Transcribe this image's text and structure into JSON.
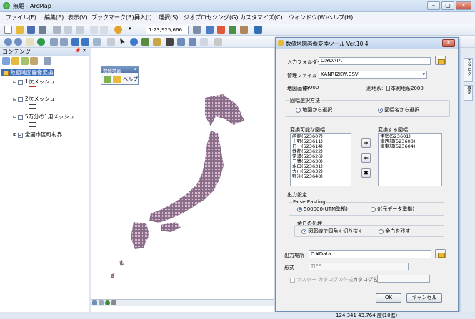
{
  "window": {
    "title": "無題 - ArcMap",
    "min": "–",
    "max": "▢",
    "close": "✕"
  },
  "menu": [
    "ファイル(F)",
    "編集(E)",
    "表示(V)",
    "ブックマーク(B)",
    "挿入(I)",
    "選択(S)",
    "ジオプロセシング(G)",
    "カスタマイズ(C)",
    "ウィンドウ(W)",
    "ヘルプ(H)"
  ],
  "toolbar": {
    "scale": "1:23,925,666"
  },
  "toc": {
    "title": "コンテンツ",
    "layer_group": "数値地図画像変換",
    "layers": [
      "1次メッシュ",
      "2次メッシュ",
      "5万分の1用メッシュ",
      "全国市区町村界"
    ]
  },
  "mini_toolbar": {
    "title": "数値地図",
    "help": "ヘルプ"
  },
  "dialog": {
    "title": "数値地図画像変換ツール Ver.10.4",
    "input_folder_label": "入力フォルダー",
    "input_folder_value": "C:¥DATA",
    "mgmt_file_label": "管理ファイル",
    "mgmt_file_value": "KANRI2KW.CSV",
    "map_image_label": "地図画像:",
    "map_image_value": "25000",
    "geodetic_label": "測地系:",
    "geodetic_value": "日本測地系2000",
    "selection_group": "図幅選択方法",
    "select_from_map": "地図から選択",
    "select_from_name": "図幅名から選択",
    "convertible_label": "変換可能な図幅",
    "convert_label": "変換する図幅",
    "convertible_list": [
      "函館(523607)",
      "上野(523611)",
      "日十(523614)",
      "鉄都(523622)",
      "常濃(523626)",
      "三豊(523630)",
      "水口(523631)",
      "大山(523632)",
      "野洲(523640)"
    ],
    "convert_list": [
      "伊勢(523601)",
      "津西部(523603)",
      "津東部(523604)"
    ],
    "output_group": "出力設定",
    "false_easting_label": "False Easting",
    "fe_opt1": "500000(UTM準拠)",
    "fe_opt2": "0(元データ準拠)",
    "margin_label": "余白の処理",
    "margin_opt1": "図郭線で四角く切り抜く",
    "margin_opt2": "余白を残す",
    "output_place_label": "出力場所",
    "output_place_value": "C:¥Data",
    "format_label": "形式",
    "format_value": "TIFF",
    "raster_catalog_label": "ラスター カタログの作成",
    "catalog_name_label": "カタログ名",
    "ok": "OK",
    "cancel": "キャンセル"
  },
  "status": {
    "coords": "124.341  43.764 度(10進)"
  },
  "right_dock": [
    "カタログ",
    "検索"
  ]
}
